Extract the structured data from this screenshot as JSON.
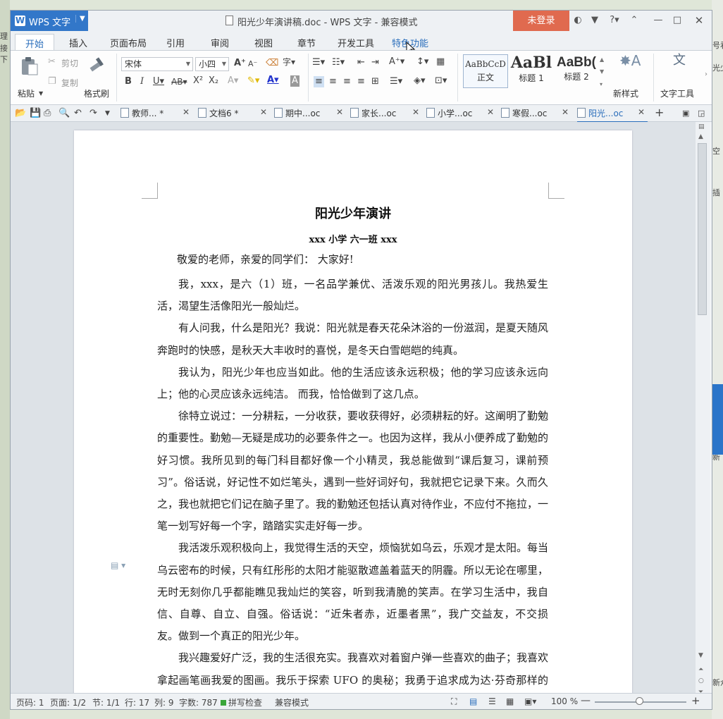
{
  "app": {
    "brand": "WPS 文字",
    "window_title": "阳光少年演讲稿.doc - WPS 文字 - 兼容模式",
    "login": "未登录"
  },
  "ribbon_tabs": [
    "开始",
    "插入",
    "页面布局",
    "引用",
    "审阅",
    "视图",
    "章节",
    "开发工具",
    "特色功能"
  ],
  "ribbon": {
    "paste": "粘贴",
    "cut": "剪切",
    "copy": "复制",
    "format_painter": "格式刷",
    "font_name": "宋体",
    "font_size": "小四",
    "styles": [
      {
        "sample": "AaBbCcD",
        "name": "正文"
      },
      {
        "sample": "AaBl",
        "name": "标题 1"
      },
      {
        "sample": "AaBb(",
        "name": "标题 2"
      }
    ],
    "new_style": "新样式",
    "text_tools": "文字工具"
  },
  "doc_tabs": [
    {
      "label": "教师... *",
      "active": false
    },
    {
      "label": "文档6 *",
      "active": false
    },
    {
      "label": "期中...oc",
      "active": false
    },
    {
      "label": "家长...oc",
      "active": false
    },
    {
      "label": "小学...oc",
      "active": false
    },
    {
      "label": "寒假...oc",
      "active": false
    },
    {
      "label": "阳光...oc",
      "active": true
    }
  ],
  "document": {
    "title": "阳光少年演讲",
    "subtitle": "xxx 小学 六一班 xxx",
    "greeting": "敬爱的老师，亲爱的同学们：  大家好!",
    "paragraphs": [
      "我，xxx，是六（1）班，一名品学兼优、活泼乐观的阳光男孩儿。我热爱生活，渴望生活像阳光一般灿烂。",
      "有人问我，什么是阳光？我说：阳光就是春天花朵沐浴的一份滋润，是夏天随风奔跑时的快感，是秋天大丰收时的喜悦，是冬天白雪皑皑的纯真。",
      "我认为，阳光少年也应当如此。他的生活应该永远积极；他的学习应该永远向上；他的心灵应该永远纯洁。  而我，恰恰做到了这几点。",
      "徐特立说过：一分耕耘，一分收获，要收获得好，必须耕耘的好。这阐明了勤勉的重要性。勤勉—无疑是成功的必要条件之一。也因为这样，我从小便养成了勤勉的好习惯。我所见到的每门科目都好像一个小精灵，我总能做到“课后复习，课前预习”。俗话说，好记性不如烂笔头，遇到一些好词好句，我就把它记录下来。久而久之，我也就把它们记在脑子里了。我的勤勉还包括认真对待作业，不应付不拖拉，一笔一划写好每一个字，踏踏实实走好每一步。",
      "我活泼乐观积极向上，我觉得生活的天空，烦恼犹如乌云，乐观才是太阳。每当乌云密布的时候，只有红彤彤的太阳才能驱散遮盖着蓝天的阴霾。所以无论在哪里，无时无刻你几乎都能瞧见我灿烂的笑容，听到我清脆的笑声。在学习生活中，我自信、自尊、自立、自强。俗话说：“近朱者赤，近墨者黑”，我广交益友，不交损友。做到一个真正的阳光少年。",
      "我兴趣爱好广泛，我的生活很充实。我喜欢对着窗户弹一些喜欢的曲子；我喜欢拿起画笔画我爱的图画。我乐于探索 UFO 的奥秘；我勇于追求成为达·芬奇那样的画家。"
    ]
  },
  "status": {
    "page_code": "页码: 1",
    "pages": "页面: 1/2",
    "section": "节: 1/1",
    "row": "行: 17",
    "col": "列: 9",
    "word_count": "字数: 787",
    "spell_check": "拼写检查",
    "compat_mode": "兼容模式",
    "zoom": "100 %"
  },
  "bg_fragments": {
    "left": [
      "理",
      "接下"
    ],
    "right": [
      "号看",
      "光少",
      "空",
      "插",
      "新",
      "新众"
    ]
  },
  "colors": {
    "accent": "#2a6ebb",
    "brand_blue": "#3277c9",
    "login_red": "#e06a4f"
  }
}
